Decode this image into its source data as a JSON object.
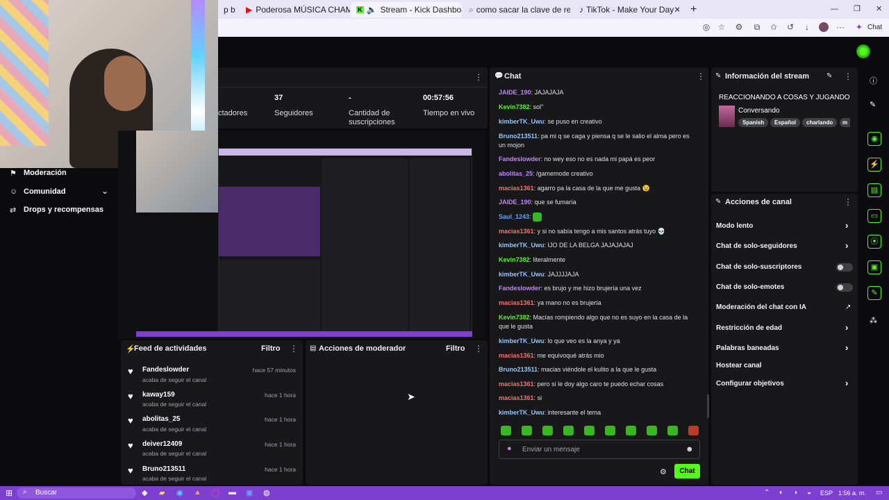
{
  "browser": {
    "tabs": [
      {
        "title": "p b"
      },
      {
        "title": "Poderosa MÚSICA CHAMÁNICA p"
      },
      {
        "title": "Stream - Kick Dashboard"
      },
      {
        "title": "como sacar la clave de retransmis"
      },
      {
        "title": "TikTok - Make Your Day"
      }
    ],
    "new_tab": "+",
    "copilot_label": "Chat"
  },
  "stats": {
    "viewers_label": "ctadores",
    "followers_value": "37",
    "followers_label": "Seguidores",
    "subs_value": "-",
    "subs_label": "Cantidad de suscripciones",
    "time_value": "00:57:56",
    "time_label": "Tiempo en vivo"
  },
  "sidebar": {
    "items": [
      {
        "label": "Moderación"
      },
      {
        "label": "Comunidad"
      },
      {
        "label": "Drops y recompensas"
      }
    ]
  },
  "feed": {
    "title": "Feed de actividades",
    "filter": "Filtro",
    "items": [
      {
        "name": "Fandeslowder",
        "sub": "acaba de seguir el canal",
        "time": "hace 57 minutos"
      },
      {
        "name": "kaway159",
        "sub": "acaba de seguir el canal",
        "time": "hace 1 hora"
      },
      {
        "name": "abolitas_25",
        "sub": "acaba de seguir el canal",
        "time": "hace 1 hora"
      },
      {
        "name": "deiver12409",
        "sub": "acaba de seguir el canal",
        "time": "hace 1 hora"
      },
      {
        "name": "Bruno213511",
        "sub": "acaba de seguir el canal",
        "time": "hace 1 hora"
      }
    ]
  },
  "mod": {
    "title": "Acciones de moderador",
    "filter": "Filtro"
  },
  "chat": {
    "title": "Chat",
    "messages": [
      {
        "user": "JAIDE_190",
        "text": "JAJAJAJA",
        "color": "#c084fc"
      },
      {
        "user": "Kevin7382",
        "text": "sol\"",
        "color": "#53fc18"
      },
      {
        "user": "kimberTK_Uwu",
        "text": "se puso en creativo",
        "color": "#93c5fd"
      },
      {
        "user": "Bruno213511",
        "text": "pa mi q se caga y piensa q se le salio el alma pero es un mojon",
        "color": "#93c5fd"
      },
      {
        "user": "Fandeslowder",
        "text": "no wey eso no es nada mi papá es peor",
        "color": "#c084fc"
      },
      {
        "user": "abolitas_25",
        "text": "/gamemode creativo",
        "color": "#c084fc"
      },
      {
        "user": "macias1361",
        "text": "agarro pa la casa de la que me gusta 😉",
        "color": "#f87171"
      },
      {
        "user": "JAIDE_190",
        "text": "que se fumaría",
        "color": "#c084fc"
      },
      {
        "user": "Saul_1243",
        "text": "",
        "color": "#60a5fa"
      },
      {
        "user": "macias1361",
        "text": "y si no sabía tengo a mis santos atrás tuyo 💀",
        "color": "#f87171"
      },
      {
        "user": "kimberTK_Uwu",
        "text": "IJO DE LA BELGA JAJAJAJAJ",
        "color": "#93c5fd"
      },
      {
        "user": "Kevin7382",
        "text": "literalmente",
        "color": "#53fc18"
      },
      {
        "user": "kimberTK_Uwu",
        "text": "JAJJJJAJA",
        "color": "#93c5fd"
      },
      {
        "user": "Fandeslowder",
        "text": "es brujo y me hizo brujería una vez",
        "color": "#c084fc"
      },
      {
        "user": "macias1361",
        "text": "ya mano no es brujería",
        "color": "#f87171"
      },
      {
        "user": "Kevin7382",
        "text": "Macías rompiendo algo que no es suyo en la casa de la que le gusta",
        "color": "#53fc18"
      },
      {
        "user": "kimberTK_Uwu",
        "text": "lo que veo es la anya y ya",
        "color": "#93c5fd"
      },
      {
        "user": "macias1361",
        "text": "me equivoqué atrás mio",
        "color": "#f87171"
      },
      {
        "user": "Bruno213511",
        "text": "macias viéndole el kulito a la que le gusta",
        "color": "#93c5fd"
      },
      {
        "user": "macias1361",
        "text": "pero si le doy algo caro te puedo echar cosas",
        "color": "#f87171"
      },
      {
        "user": "macias1361",
        "text": "si",
        "color": "#f87171"
      },
      {
        "user": "kimberTK_Uwu",
        "text": "interesante el tema",
        "color": "#93c5fd"
      }
    ],
    "placeholder": "Enviar un mensaje",
    "send": "Chat"
  },
  "stream_info": {
    "title": "Información del stream",
    "stream_title": "REACCIONANDO A COSAS Y JUGANDO",
    "category": "Conversando",
    "tags": [
      "Spanish",
      "Español",
      "charlando",
      "m"
    ]
  },
  "channel": {
    "title": "Acciones de canal",
    "items": [
      {
        "label": "Modo lento",
        "kind": "chevron"
      },
      {
        "label": "Chat de solo-seguidores",
        "kind": "chevron"
      },
      {
        "label": "Chat de solo-suscriptores",
        "kind": "toggle"
      },
      {
        "label": "Chat de solo-emotes",
        "kind": "toggle"
      },
      {
        "label": "Moderación del chat con IA",
        "kind": "external"
      },
      {
        "label": "Restricción de edad",
        "kind": "chevron"
      },
      {
        "label": "Palabras baneadas",
        "kind": "chevron"
      },
      {
        "label": "Hostear canal",
        "kind": "none"
      },
      {
        "label": "Configurar objetivos",
        "kind": "chevron"
      }
    ]
  },
  "taskbar": {
    "search": "Buscar",
    "lang": "ESP",
    "time": "1:56 a. m."
  },
  "colors": {
    "accent": "#53fc18",
    "panel": "#18181b",
    "taskbar": "#7c3fd0"
  }
}
